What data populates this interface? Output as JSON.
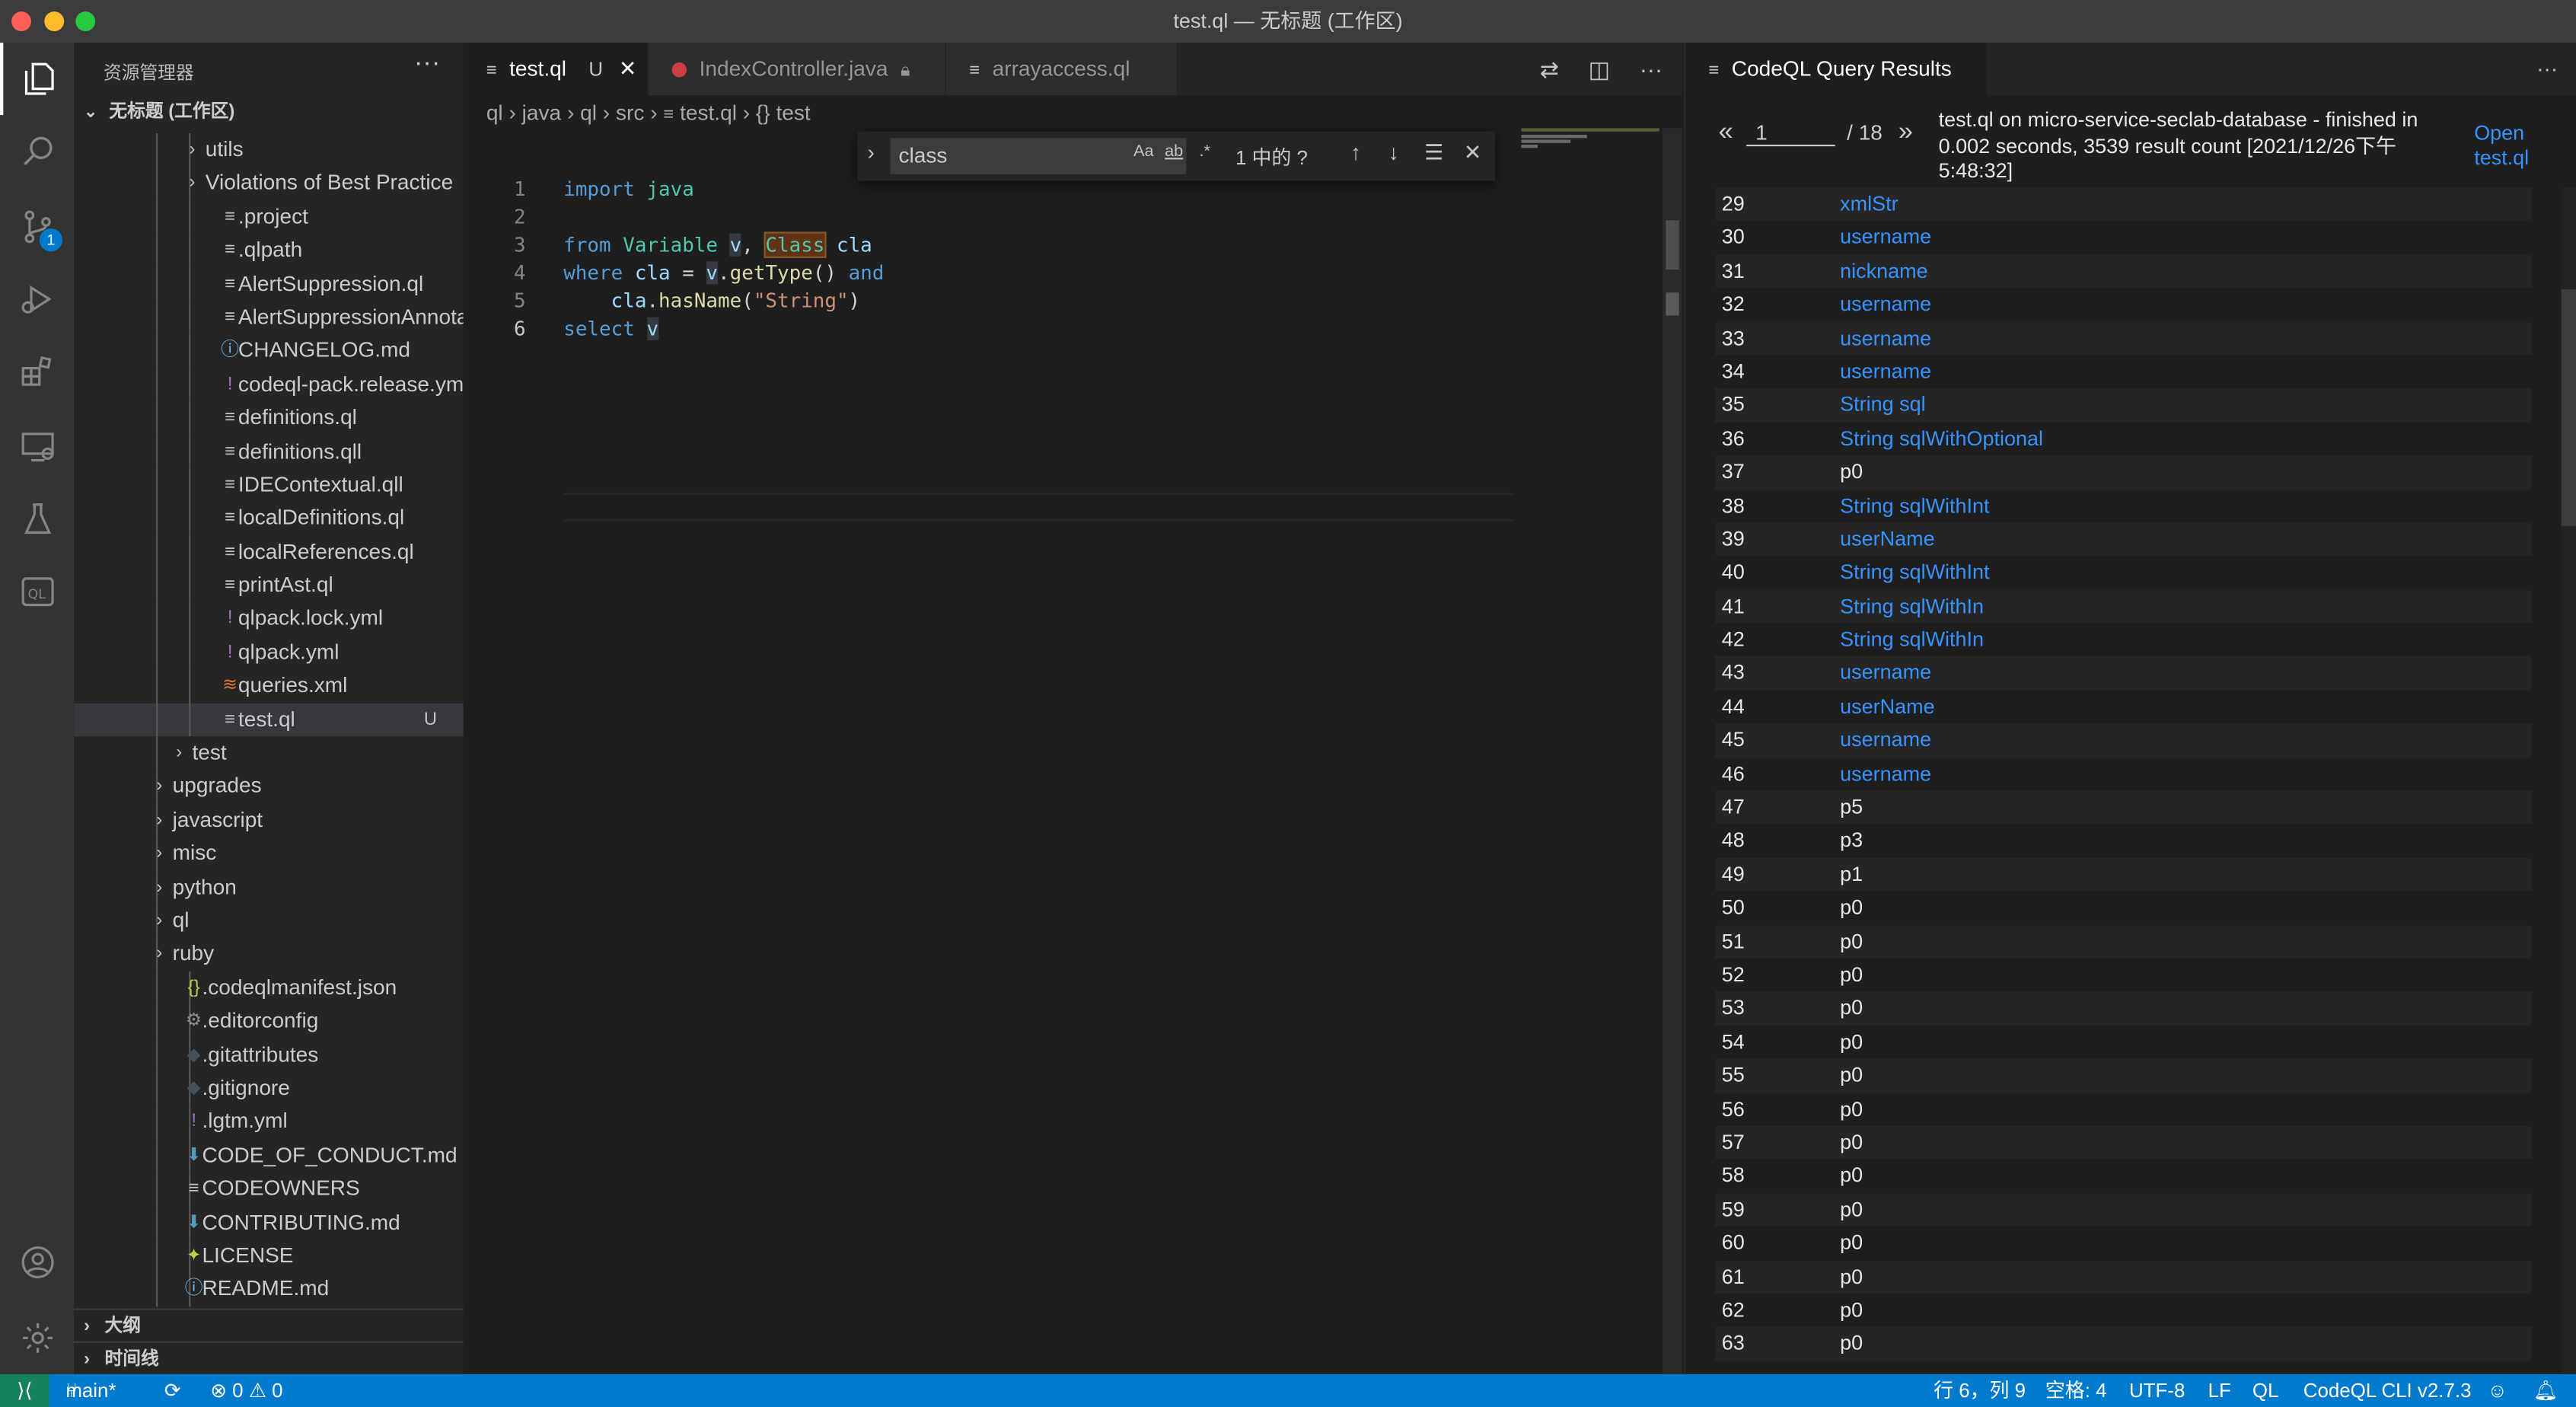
{
  "window": {
    "title": "test.ql — 无标题 (工作区)"
  },
  "sidebar": {
    "title": "资源管理器",
    "workspace": "无标题 (工作区)",
    "items": [
      {
        "label": "utils",
        "type": "folder"
      },
      {
        "label": "Violations of Best Practice",
        "type": "folder"
      },
      {
        "label": ".project",
        "type": "file"
      },
      {
        "label": ".qlpath",
        "type": "file"
      },
      {
        "label": "AlertSuppression.ql",
        "type": "file"
      },
      {
        "label": "AlertSuppressionAnnotations...",
        "type": "file"
      },
      {
        "label": "CHANGELOG.md",
        "type": "file"
      },
      {
        "label": "codeql-pack.release.yml",
        "type": "file"
      },
      {
        "label": "definitions.ql",
        "type": "file"
      },
      {
        "label": "definitions.qll",
        "type": "file"
      },
      {
        "label": "IDEContextual.qll",
        "type": "file"
      },
      {
        "label": "localDefinitions.ql",
        "type": "file"
      },
      {
        "label": "localReferences.ql",
        "type": "file"
      },
      {
        "label": "printAst.ql",
        "type": "file"
      },
      {
        "label": "qlpack.lock.yml",
        "type": "file"
      },
      {
        "label": "qlpack.yml",
        "type": "file"
      },
      {
        "label": "queries.xml",
        "type": "file"
      },
      {
        "label": "test.ql",
        "type": "file",
        "flag": "U"
      },
      {
        "label": "test",
        "type": "folder"
      },
      {
        "label": "upgrades",
        "type": "folder"
      },
      {
        "label": "javascript",
        "type": "folder"
      },
      {
        "label": "misc",
        "type": "folder"
      },
      {
        "label": "python",
        "type": "folder"
      },
      {
        "label": "ql",
        "type": "folder"
      },
      {
        "label": "ruby",
        "type": "folder"
      },
      {
        "label": ".codeqlmanifest.json",
        "type": "file"
      },
      {
        "label": ".editorconfig",
        "type": "file"
      },
      {
        "label": ".gitattributes",
        "type": "file"
      },
      {
        "label": ".gitignore",
        "type": "file"
      },
      {
        "label": ".lgtm.yml",
        "type": "file"
      },
      {
        "label": "CODE_OF_CONDUCT.md",
        "type": "file"
      },
      {
        "label": "CODEOWNERS",
        "type": "file"
      },
      {
        "label": "CONTRIBUTING.md",
        "type": "file"
      },
      {
        "label": "LICENSE",
        "type": "file"
      },
      {
        "label": "README.md",
        "type": "file"
      }
    ],
    "outline": "大纲",
    "timeline": "时间线"
  },
  "activity": {
    "scm_badge": "1"
  },
  "editor": {
    "tabs": [
      {
        "label": "test.ql",
        "flag": "U"
      },
      {
        "label": "IndexController.java"
      },
      {
        "label": "arrayaccess.ql"
      }
    ],
    "breadcrumb": [
      "ql",
      "java",
      "ql",
      "src",
      "test.ql",
      "{} test"
    ],
    "line_numbers": [
      "1",
      "2",
      "3",
      "4",
      "5",
      "6"
    ],
    "find": {
      "query": "class",
      "count": "1 中的 ?",
      "opt_case": "Aa",
      "opt_word": "ab",
      "opt_regex": ".*"
    }
  },
  "results": {
    "tab_label": "CodeQL Query Results",
    "page": "1",
    "page_total": "/ 18",
    "message": "test.ql on micro-service-seclab-database - finished in 0.002 seconds, 3539 result count [2021/12/26下午5:48:32]",
    "open_link": "Open test.ql",
    "rows": [
      {
        "n": "29",
        "v": "xmlStr",
        "link": true
      },
      {
        "n": "30",
        "v": "username",
        "link": true
      },
      {
        "n": "31",
        "v": "nickname",
        "link": true
      },
      {
        "n": "32",
        "v": "username",
        "link": true
      },
      {
        "n": "33",
        "v": "username",
        "link": true
      },
      {
        "n": "34",
        "v": "username",
        "link": true
      },
      {
        "n": "35",
        "v": "String sql",
        "link": true
      },
      {
        "n": "36",
        "v": "String sqlWithOptional",
        "link": true
      },
      {
        "n": "37",
        "v": "p0",
        "link": false
      },
      {
        "n": "38",
        "v": "String sqlWithInt",
        "link": true
      },
      {
        "n": "39",
        "v": "userName",
        "link": true
      },
      {
        "n": "40",
        "v": "String sqlWithInt",
        "link": true
      },
      {
        "n": "41",
        "v": "String sqlWithIn",
        "link": true
      },
      {
        "n": "42",
        "v": "String sqlWithIn",
        "link": true
      },
      {
        "n": "43",
        "v": "username",
        "link": true
      },
      {
        "n": "44",
        "v": "userName",
        "link": true
      },
      {
        "n": "45",
        "v": "username",
        "link": true
      },
      {
        "n": "46",
        "v": "username",
        "link": true
      },
      {
        "n": "47",
        "v": "p5",
        "link": false
      },
      {
        "n": "48",
        "v": "p3",
        "link": false
      },
      {
        "n": "49",
        "v": "p1",
        "link": false
      },
      {
        "n": "50",
        "v": "p0",
        "link": false
      },
      {
        "n": "51",
        "v": "p0",
        "link": false
      },
      {
        "n": "52",
        "v": "p0",
        "link": false
      },
      {
        "n": "53",
        "v": "p0",
        "link": false
      },
      {
        "n": "54",
        "v": "p0",
        "link": false
      },
      {
        "n": "55",
        "v": "p0",
        "link": false
      },
      {
        "n": "56",
        "v": "p0",
        "link": false
      },
      {
        "n": "57",
        "v": "p0",
        "link": false
      },
      {
        "n": "58",
        "v": "p0",
        "link": false
      },
      {
        "n": "59",
        "v": "p0",
        "link": false
      },
      {
        "n": "60",
        "v": "p0",
        "link": false
      },
      {
        "n": "61",
        "v": "p0",
        "link": false
      },
      {
        "n": "62",
        "v": "p0",
        "link": false
      },
      {
        "n": "63",
        "v": "p0",
        "link": false
      }
    ]
  },
  "status": {
    "branch": "main*",
    "problems": "⊗ 0 ⚠ 0",
    "cursor": "行 6，列 9",
    "spaces": "空格: 4",
    "encoding": "UTF-8",
    "eol": "LF",
    "language": "QL",
    "cli": "CodeQL CLI v2.7.3"
  },
  "colors": {
    "accent": "#007acc",
    "link": "#3794ff",
    "background": "#1e1e1e",
    "sidebar": "#252526"
  }
}
